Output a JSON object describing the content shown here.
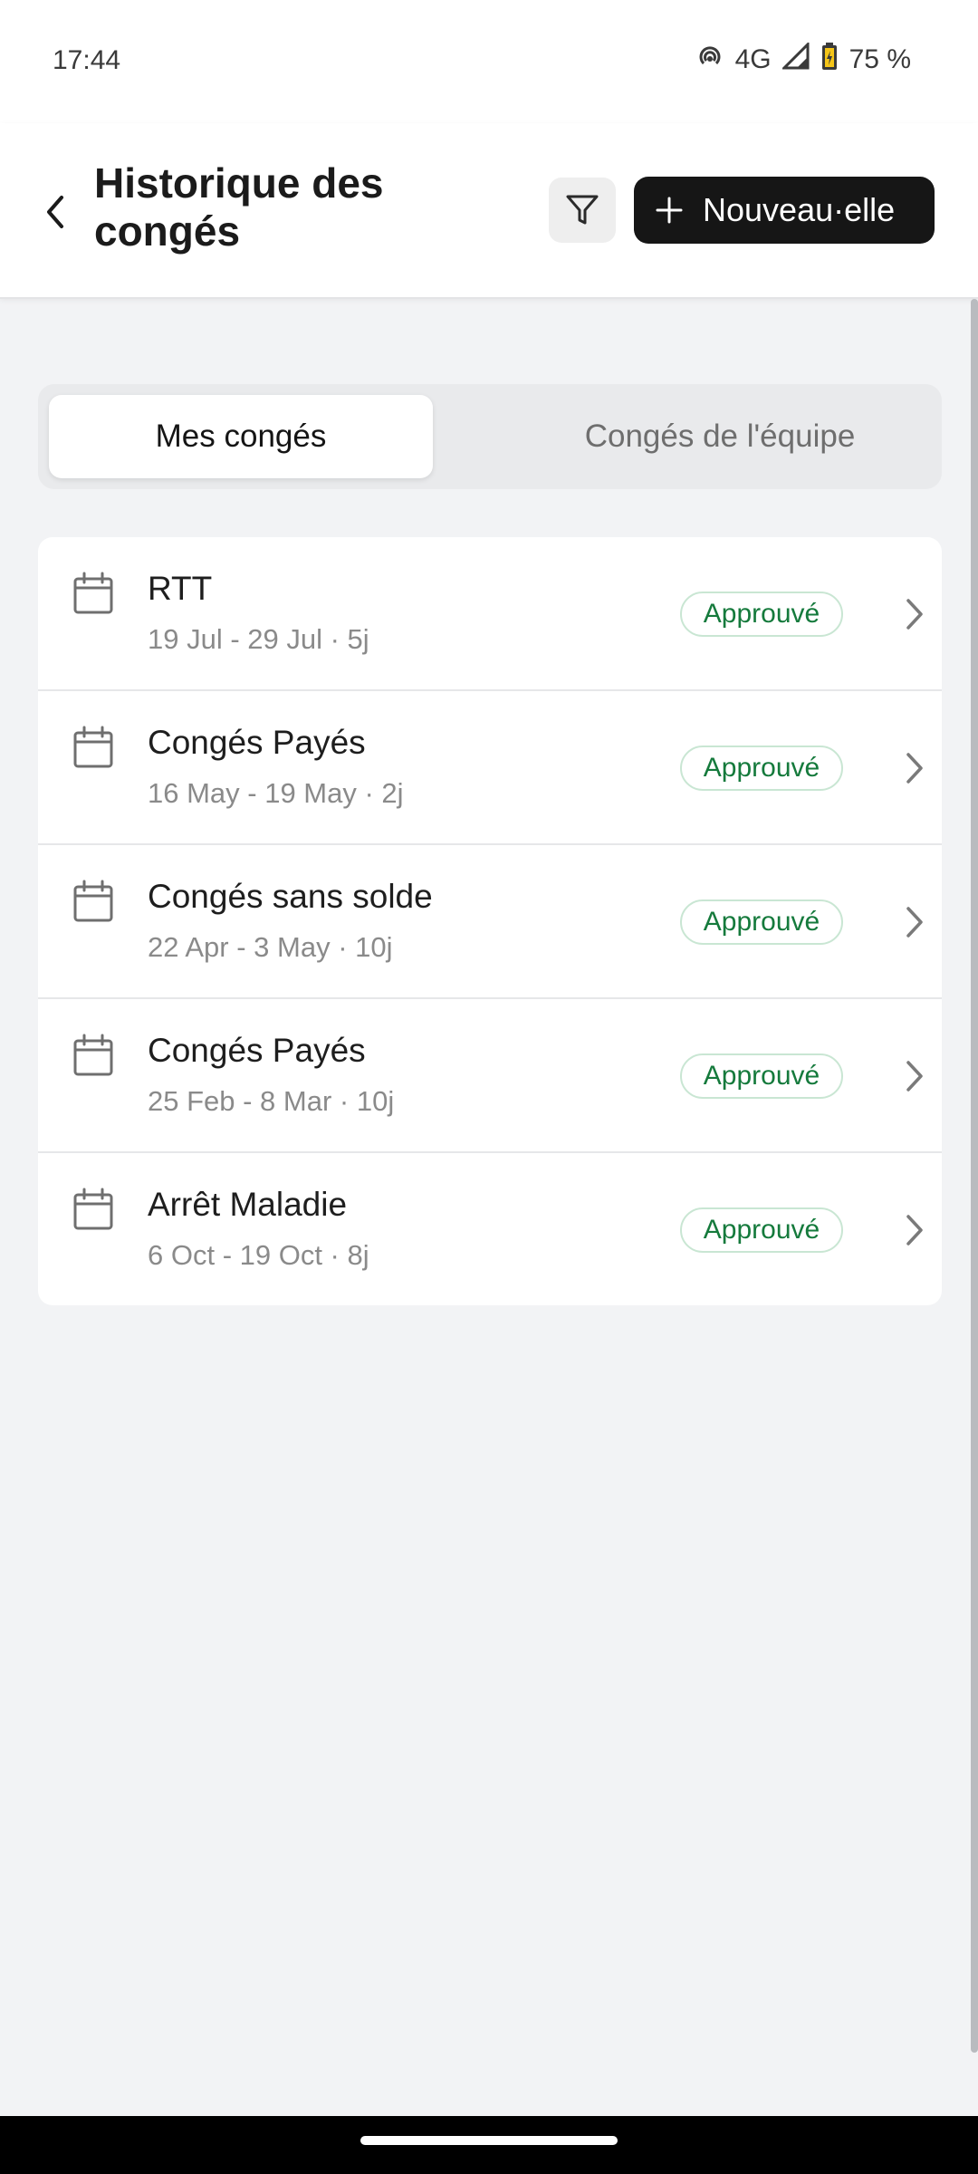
{
  "status_bar": {
    "time": "17:44",
    "network": "4G",
    "battery": "75 %",
    "icons": [
      "hotspot-icon",
      "signal-icon",
      "battery-icon"
    ]
  },
  "header": {
    "title": "Historique des congés",
    "new_button_label": "Nouveau·elle",
    "icons": [
      "back-chevron-icon",
      "filter-icon",
      "plus-icon"
    ]
  },
  "tabs": {
    "active": "Mes congés",
    "inactive": "Congés de l'équipe"
  },
  "leaves": [
    {
      "type": "RTT",
      "details": "19 Jul - 29 Jul · 5j",
      "status": "Approuvé"
    },
    {
      "type": "Congés Payés",
      "details": "16 May - 19 May · 2j",
      "status": "Approuvé"
    },
    {
      "type": "Congés sans solde",
      "details": "22 Apr - 3 May · 10j",
      "status": "Approuvé"
    },
    {
      "type": "Congés Payés",
      "details": "25 Feb - 8 Mar · 10j",
      "status": "Approuvé"
    },
    {
      "type": "Arrêt Maladie",
      "details": "6 Oct - 19 Oct · 8j",
      "status": "Approuvé"
    }
  ],
  "colors": {
    "accent_dark": "#161616",
    "approved_text": "#157a3c",
    "approved_border": "#c9e6d3",
    "background": "#f2f3f5"
  }
}
